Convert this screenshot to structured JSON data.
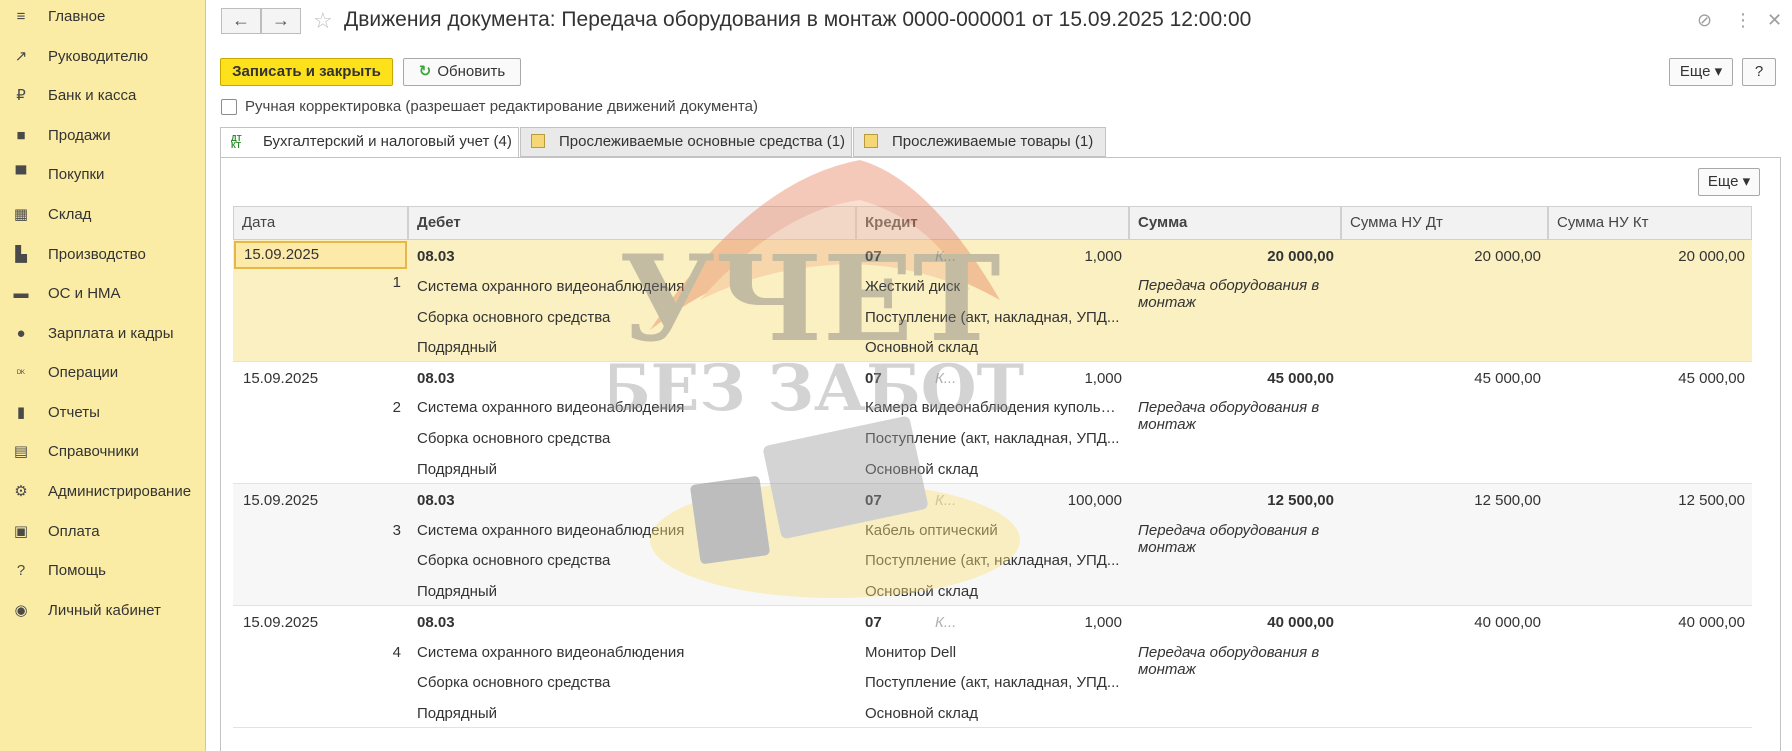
{
  "sidebar": {
    "items": [
      {
        "icon": "menu-icon",
        "glyph": "≡",
        "label": "Главное"
      },
      {
        "icon": "trend-icon",
        "glyph": "↗",
        "label": "Руководителю"
      },
      {
        "icon": "coin-icon",
        "glyph": "₽",
        "label": "Банк и касса"
      },
      {
        "icon": "bag-icon",
        "glyph": "■",
        "label": "Продажи"
      },
      {
        "icon": "cart-icon",
        "glyph": "▀",
        "label": "Покупки"
      },
      {
        "icon": "warehouse-icon",
        "glyph": "▦",
        "label": "Склад"
      },
      {
        "icon": "factory-icon",
        "glyph": "▙",
        "label": "Производство"
      },
      {
        "icon": "truck-icon",
        "glyph": "▬",
        "label": "ОС и НМА"
      },
      {
        "icon": "person-icon",
        "glyph": "●",
        "label": "Зарплата и кадры"
      },
      {
        "icon": "dtkt-icon",
        "glyph": "ᴰᴷ",
        "label": "Операции"
      },
      {
        "icon": "bar-chart-icon",
        "glyph": "▮",
        "label": "Отчеты"
      },
      {
        "icon": "books-icon",
        "glyph": "▤",
        "label": "Справочники"
      },
      {
        "icon": "gear-icon",
        "glyph": "⚙",
        "label": "Администрирование"
      },
      {
        "icon": "wallet-icon",
        "glyph": "▣",
        "label": "Оплата"
      },
      {
        "icon": "help-icon",
        "glyph": "?",
        "label": "Помощь"
      },
      {
        "icon": "account-icon",
        "glyph": "◉",
        "label": "Личный кабинет"
      }
    ]
  },
  "header": {
    "back": "←",
    "forward": "→",
    "star": "☆",
    "title": "Движения документа: Передача оборудования в монтаж 0000-000001 от 15.09.2025 12:00:00",
    "link_icon": "⊘",
    "more_icon": "⋮",
    "close_icon": "✕"
  },
  "toolbar": {
    "save_close": "Записать и закрыть",
    "refresh": "Обновить",
    "more": "Еще ▾",
    "help": "?"
  },
  "manual": {
    "label": "Ручная корректировка (разрешает редактирование движений документа)",
    "checked": false
  },
  "tabs": [
    {
      "label": "Бухгалтерский и налоговый учет (4)",
      "active": true
    },
    {
      "label": "Прослеживаемые основные средства (1)",
      "active": false
    },
    {
      "label": "Прослеживаемые товары (1)",
      "active": false
    }
  ],
  "table": {
    "more": "Еще ▾",
    "columns": [
      "Дата",
      "Дебет",
      "Кредит",
      "Сумма",
      "Сумма НУ Дт",
      "Сумма НУ Кт"
    ],
    "rows": [
      {
        "date": "15.09.2025",
        "num": "1",
        "debit_acc": "08.03",
        "debit_sub1": "Система охранного видеонаблюдения",
        "debit_sub2": "Сборка основного средства",
        "debit_sub3": "Подрядный",
        "credit_acc": "07",
        "credit_k": "К...",
        "qty": "1,000",
        "credit_sub1": "Жесткий диск",
        "credit_sub2": "Поступление (акт, накладная, УПД...",
        "credit_sub3": "Основной склад",
        "sum": "20 000,00",
        "content": "Передача оборудования в монтаж",
        "nu_dt": "20 000,00",
        "nu_kt": "20 000,00"
      },
      {
        "date": "15.09.2025",
        "num": "2",
        "debit_acc": "08.03",
        "debit_sub1": "Система охранного видеонаблюдения",
        "debit_sub2": "Сборка основного средства",
        "debit_sub3": "Подрядный",
        "credit_acc": "07",
        "credit_k": "К...",
        "qty": "1,000",
        "credit_sub1": "Камера видеонаблюдения купольн...",
        "credit_sub2": "Поступление (акт, накладная, УПД...",
        "credit_sub3": "Основной склад",
        "sum": "45 000,00",
        "content": "Передача оборудования в монтаж",
        "nu_dt": "45 000,00",
        "nu_kt": "45 000,00"
      },
      {
        "date": "15.09.2025",
        "num": "3",
        "debit_acc": "08.03",
        "debit_sub1": "Система охранного видеонаблюдения",
        "debit_sub2": "Сборка основного средства",
        "debit_sub3": "Подрядный",
        "credit_acc": "07",
        "credit_k": "К...",
        "qty": "100,000",
        "credit_sub1": "Кабель оптический",
        "credit_sub2": "Поступление (акт, накладная, УПД...",
        "credit_sub3": "Основной склад",
        "sum": "12 500,00",
        "content": "Передача оборудования в монтаж",
        "nu_dt": "12 500,00",
        "nu_kt": "12 500,00"
      },
      {
        "date": "15.09.2025",
        "num": "4",
        "debit_acc": "08.03",
        "debit_sub1": "Система охранного видеонаблюдения",
        "debit_sub2": "Сборка основного средства",
        "debit_sub3": "Подрядный",
        "credit_acc": "07",
        "credit_k": "К...",
        "qty": "1,000",
        "credit_sub1": "Монитор Dell",
        "credit_sub2": "Поступление (акт, накладная, УПД...",
        "credit_sub3": "Основной склад",
        "sum": "40 000,00",
        "content": "Передача оборудования в монтаж",
        "nu_dt": "40 000,00",
        "nu_kt": "40 000,00"
      }
    ]
  },
  "watermark": {
    "line1": "УЧЕТ",
    "line2": "БЕЗ ЗАБОТ"
  },
  "colors": {
    "sidebar_bg": "#fbeca5",
    "primary_button": "#fde11b",
    "selected_row": "#fbf0c2"
  }
}
